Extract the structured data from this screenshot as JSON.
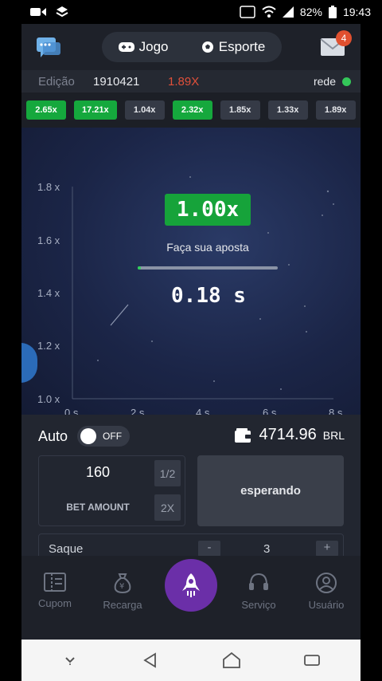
{
  "status_bar": {
    "battery": "82%",
    "time": "19:43"
  },
  "header": {
    "tab_game": "Jogo",
    "tab_sport": "Esporte",
    "mail_badge": "4"
  },
  "round": {
    "edition_label": "Edição",
    "edition_number": "1910421",
    "last_multiplier": "1.89X",
    "network_label": "rede"
  },
  "history": [
    "2.65x",
    "17.21x",
    "1.04x",
    "2.32x",
    "1.85x",
    "1.33x",
    "1.89x"
  ],
  "history_wins": [
    true,
    true,
    false,
    true,
    false,
    false,
    false
  ],
  "chart": {
    "current_multiplier": "1.00x",
    "status_text": "Faça sua aposta",
    "countdown": "0.18 s",
    "progress_fraction": 0.02,
    "y_ticks": [
      "1.8 x",
      "1.6 x",
      "1.4 x",
      "1.2 x",
      "1.0 x"
    ],
    "x_ticks": [
      "0 s",
      "2 s",
      "4 s",
      "6 s",
      "8 s"
    ]
  },
  "controls": {
    "auto_label": "Auto",
    "auto_state": "OFF",
    "balance": "4714.96",
    "currency": "BRL",
    "bet_amount": "160",
    "bet_label": "BET AMOUNT",
    "half_label": "1/2",
    "double_label": "2X",
    "action_label": "esperando",
    "cashout_label": "Saque",
    "cashout_value": "3",
    "minus_label": "-",
    "plus_label": "+"
  },
  "bottom_nav": {
    "coupon": "Cupom",
    "recharge": "Recarga",
    "service": "Serviço",
    "user": "Usuário"
  },
  "colors": {
    "win_chip": "#15a83d",
    "last_multiplier": "#e0503a",
    "network_ok": "#34c759",
    "center_nav": "#6b2fa8"
  }
}
